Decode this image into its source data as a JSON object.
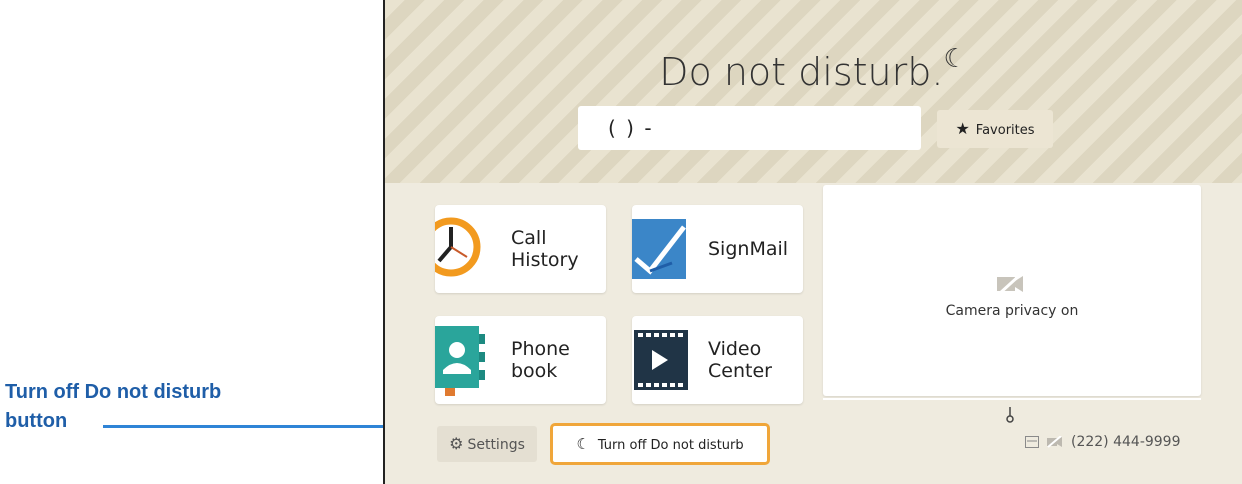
{
  "annotation": {
    "text_line1": "Turn off Do not disturb",
    "text_line2": "button"
  },
  "header": {
    "title": "Do not disturb.",
    "dial_value": "(   )    -",
    "favorites_label": "Favorites"
  },
  "tiles": [
    {
      "label_line1": "Call",
      "label_line2": "History"
    },
    {
      "label_line1": "SignMail",
      "label_line2": ""
    },
    {
      "label_line1": "Phone",
      "label_line2": "book"
    },
    {
      "label_line1": "Video",
      "label_line2": "Center"
    }
  ],
  "camera": {
    "status_text": "Camera privacy on"
  },
  "bottom": {
    "settings_label": "Settings",
    "dnd_button_label": "Turn off Do not disturb",
    "phone_number": "(222) 444-9999"
  },
  "colors": {
    "accent_orange": "#f0a63a",
    "annotation_blue": "#1f5ea8",
    "arrow_blue": "#2f84d6",
    "signmail_blue": "#3b86c8",
    "phonebook_teal": "#2aa59b",
    "video_navy": "#203446"
  },
  "icons": [
    "clock-icon",
    "signmail-icon",
    "phonebook-icon",
    "video-film-icon",
    "camera-off-icon",
    "gear-icon",
    "moon-icon",
    "star-icon",
    "message-icon"
  ]
}
